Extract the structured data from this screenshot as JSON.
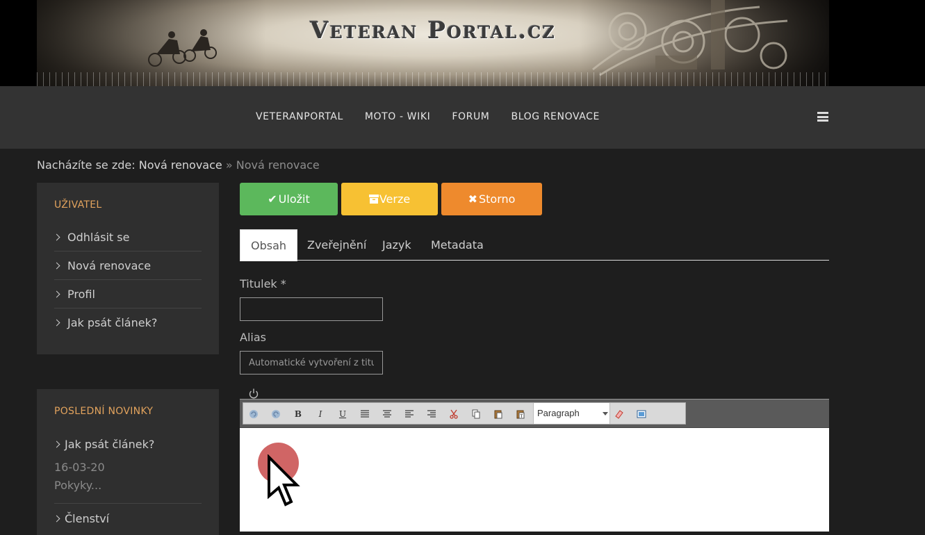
{
  "site": {
    "title": "Veteran Portal.cz"
  },
  "nav": {
    "items": [
      "VETERANPORTAL",
      "MOTO - WIKI",
      "FORUM",
      "BLOG RENOVACE"
    ]
  },
  "breadcrumb": {
    "prefix": "Nacházíte se zde:",
    "link": "Nová renovace",
    "separator": "»",
    "current": "Nová renovace"
  },
  "sidebar": {
    "user_title": "UŽIVATEL",
    "user_items": [
      "Odhlásit se",
      "Nová renovace",
      "Profil",
      "Jak psát článek?"
    ],
    "news_title": "POSLEDNÍ NOVINKY",
    "news": [
      {
        "title": "Jak psát článek?",
        "date": "16-03-20",
        "desc": "Pokyky..."
      },
      {
        "title": "Členství"
      }
    ]
  },
  "actions": {
    "save": "Uložit",
    "version": "Verze",
    "cancel": "Storno",
    "colors": {
      "save": "#5cb85c",
      "version": "#f7c133",
      "cancel": "#ee8a2d"
    }
  },
  "tabs": [
    "Obsah",
    "Zveřejnění",
    "Jazyk",
    "Metadata"
  ],
  "form": {
    "title_label": "Titulek *",
    "title_value": "",
    "alias_label": "Alias",
    "alias_placeholder": "Automatické vytvoření z titulku"
  },
  "editor": {
    "format_value": "Paragraph",
    "toolbar_icons": [
      "undo-icon",
      "redo-icon",
      "bold-icon",
      "italic-icon",
      "underline-icon",
      "justify-icon",
      "align-center-icon",
      "align-left-icon",
      "align-right-icon",
      "cut-icon",
      "copy-icon",
      "paste-icon",
      "paste-text-icon",
      "eraser-icon",
      "image-icon"
    ],
    "bold": "B",
    "italic": "I",
    "underline": "U"
  }
}
